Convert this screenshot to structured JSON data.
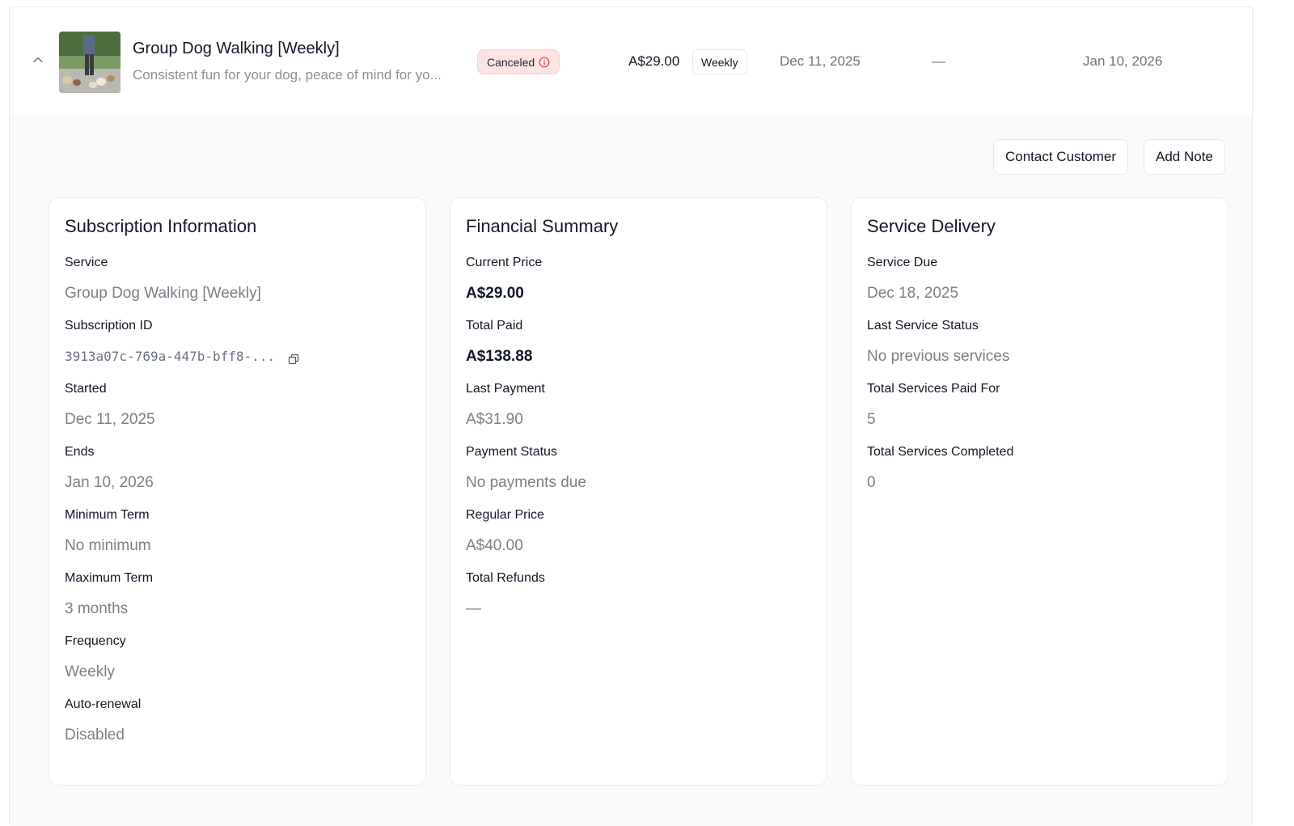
{
  "row": {
    "title": "Group Dog Walking [Weekly]",
    "subtitle": "Consistent fun for your dog, peace of mind for yo...",
    "status": "Canceled",
    "price": "A$29.00",
    "frequency": "Weekly",
    "start_date": "Dec 11, 2025",
    "middle": "—",
    "end_date": "Jan 10, 2026"
  },
  "actions": {
    "contact": "Contact Customer",
    "note": "Add Note"
  },
  "subscription": {
    "title": "Subscription Information",
    "fields": [
      {
        "label": "Service",
        "value": "Group Dog Walking [Weekly]"
      },
      {
        "label": "Subscription ID",
        "value": "3913a07c-769a-447b-bff8-..."
      },
      {
        "label": "Started",
        "value": "Dec 11, 2025"
      },
      {
        "label": "Ends",
        "value": "Jan 10, 2026"
      },
      {
        "label": "Minimum Term",
        "value": "No minimum"
      },
      {
        "label": "Maximum Term",
        "value": "3 months"
      },
      {
        "label": "Frequency",
        "value": "Weekly"
      },
      {
        "label": "Auto-renewal",
        "value": "Disabled"
      }
    ]
  },
  "financial": {
    "title": "Financial Summary",
    "fields": [
      {
        "label": "Current Price",
        "value": "A$29.00"
      },
      {
        "label": "Total Paid",
        "value": "A$138.88"
      },
      {
        "label": "Last Payment",
        "value": "A$31.90"
      },
      {
        "label": "Payment Status",
        "value": "No payments due"
      },
      {
        "label": "Regular Price",
        "value": "A$40.00"
      },
      {
        "label": "Total Refunds",
        "value": "—"
      }
    ]
  },
  "delivery": {
    "title": "Service Delivery",
    "fields": [
      {
        "label": "Service Due",
        "value": "Dec 18, 2025"
      },
      {
        "label": "Last Service Status",
        "value": "No previous services"
      },
      {
        "label": "Total Services Paid For",
        "value": "5"
      },
      {
        "label": "Total Services Completed",
        "value": "0"
      }
    ]
  },
  "icons": {
    "collapse": "chevron-up-icon",
    "status_info": "info-circle-icon",
    "copy": "copy-icon"
  },
  "colors": {
    "canceled_bg": "#fde4e4",
    "canceled_icon": "#e5484d",
    "muted_text": "#7b7f87",
    "panel_bg": "#fafafa"
  }
}
